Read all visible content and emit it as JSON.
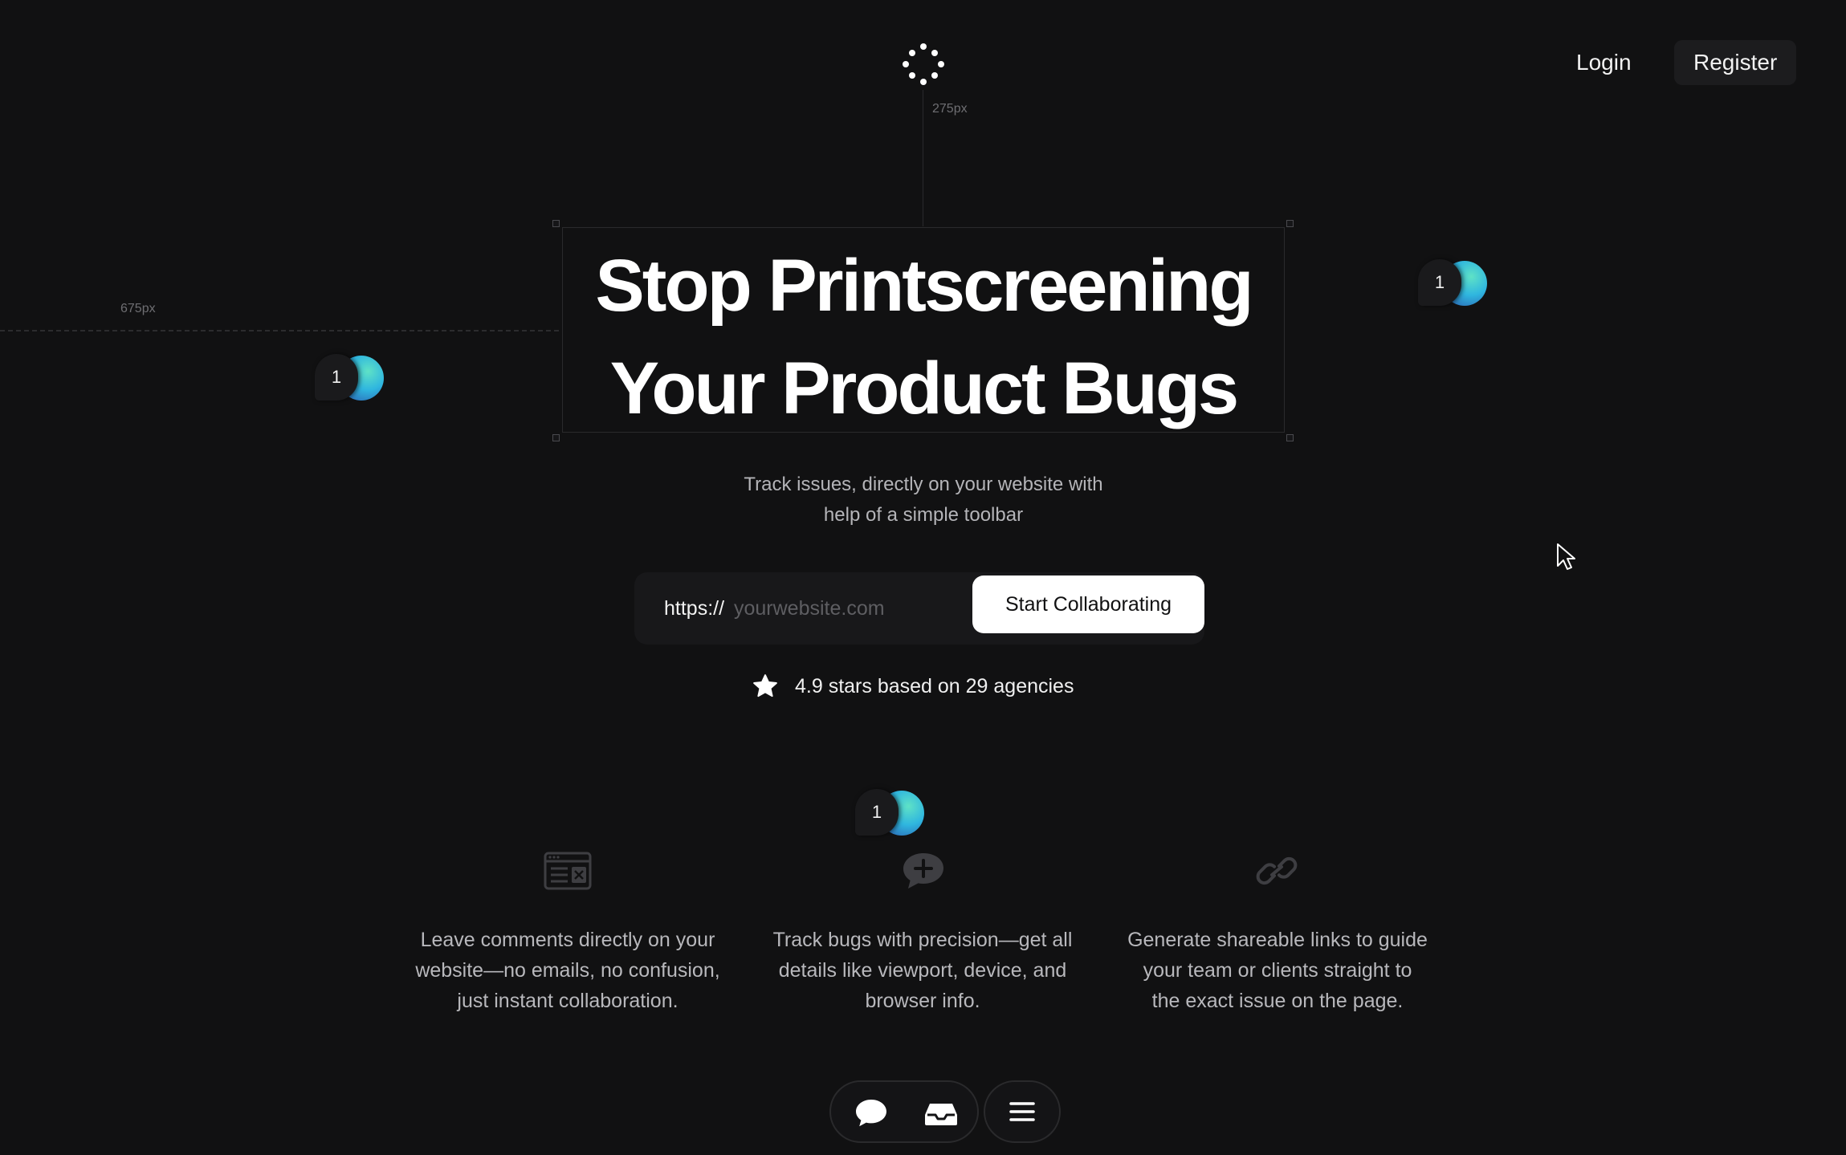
{
  "nav": {
    "logo": "dots-logo-icon",
    "login_label": "Login",
    "register_label": "Register"
  },
  "guides": {
    "top_measure": "275px",
    "left_measure": "675px"
  },
  "hero": {
    "title_line1": "Stop Printscreening",
    "title_line2": "Your Product Bugs",
    "subtitle_line1": "Track issues, directly on your website with",
    "subtitle_line2": "help of a simple toolbar"
  },
  "url_form": {
    "prefix": "https://",
    "placeholder": "yourwebsite.com",
    "value": "",
    "button_label": "Start Collaborating"
  },
  "rating": {
    "icon": "star-icon",
    "text": "4.9 stars based on 29 agencies"
  },
  "pins": [
    {
      "count": "1"
    },
    {
      "count": "1"
    },
    {
      "count": "1"
    }
  ],
  "features": [
    {
      "icon": "browser-comment-icon",
      "lines": [
        "Leave comments directly on your",
        "website—no emails, no confusion,",
        "just instant collaboration."
      ]
    },
    {
      "icon": "add-comment-icon",
      "lines": [
        "Track bugs with precision—get all",
        "details like viewport, device, and",
        "browser info."
      ]
    },
    {
      "icon": "link-icon",
      "lines": [
        "Generate shareable links to guide",
        "your team or clients straight to",
        "the exact issue on the page."
      ]
    }
  ],
  "toolbar": {
    "items": [
      "comment-icon",
      "inbox-icon",
      "menu-icon"
    ]
  },
  "colors": {
    "background": "#111112",
    "text": "#ffffff",
    "muted_text": "#b4b4b8",
    "pin_gradient_start": "#5fe2c6",
    "pin_gradient_end": "#2a4ea8"
  }
}
